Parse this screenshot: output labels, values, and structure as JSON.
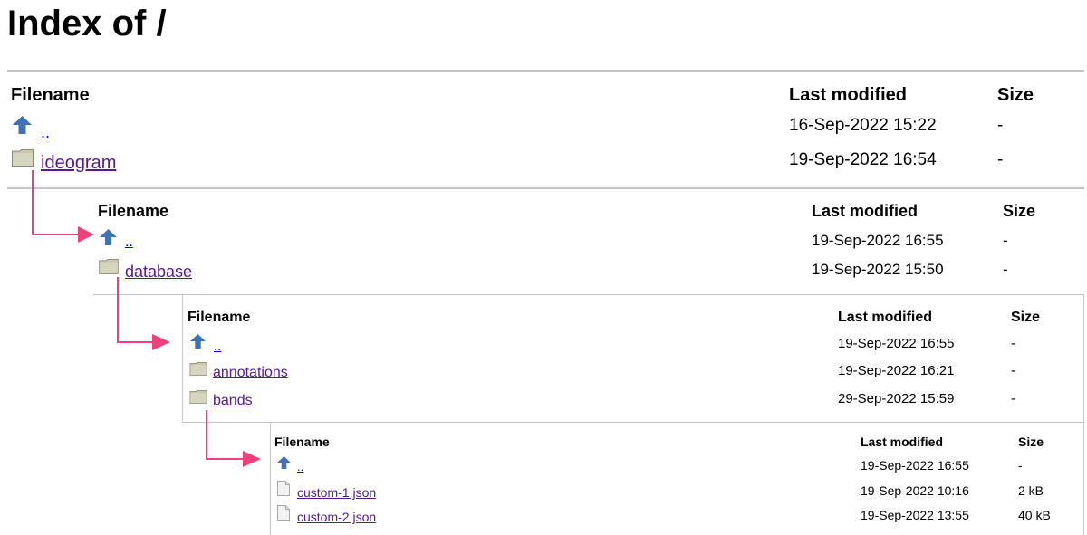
{
  "page": {
    "title": "Index of /"
  },
  "columns": {
    "filename": "Filename",
    "modified": "Last modified",
    "size": "Size"
  },
  "listings": [
    {
      "rows": [
        {
          "name": "..",
          "icon": "up-arrow-icon",
          "modified": "16-Sep-2022 15:22",
          "size": "-"
        },
        {
          "name": "ideogram",
          "icon": "folder-icon",
          "modified": "19-Sep-2022 16:54",
          "size": "-"
        }
      ]
    },
    {
      "rows": [
        {
          "name": "..",
          "icon": "up-arrow-icon",
          "modified": "19-Sep-2022 16:55",
          "size": "-"
        },
        {
          "name": "database",
          "icon": "folder-icon",
          "modified": "19-Sep-2022 15:50",
          "size": "-"
        }
      ]
    },
    {
      "rows": [
        {
          "name": "..",
          "icon": "up-arrow-icon",
          "modified": "19-Sep-2022 16:55",
          "size": "-"
        },
        {
          "name": "annotations",
          "icon": "folder-icon",
          "modified": "19-Sep-2022 16:21",
          "size": "-"
        },
        {
          "name": "bands",
          "icon": "folder-icon",
          "modified": "29-Sep-2022 15:59",
          "size": "-"
        }
      ]
    },
    {
      "rows": [
        {
          "name": "..",
          "icon": "up-arrow-icon",
          "modified": "19-Sep-2022 16:55",
          "size": "-"
        },
        {
          "name": "custom-1.json",
          "icon": "file-icon",
          "modified": "19-Sep-2022 10:16",
          "size": "2 kB"
        },
        {
          "name": "custom-2.json",
          "icon": "file-icon",
          "modified": "19-Sep-2022 13:55",
          "size": "40 kB"
        }
      ]
    }
  ],
  "colors": {
    "arrow": "#f0407a",
    "link_visited": "#551a8b",
    "link": "#0000ee",
    "rule": "#c4c4c4"
  }
}
